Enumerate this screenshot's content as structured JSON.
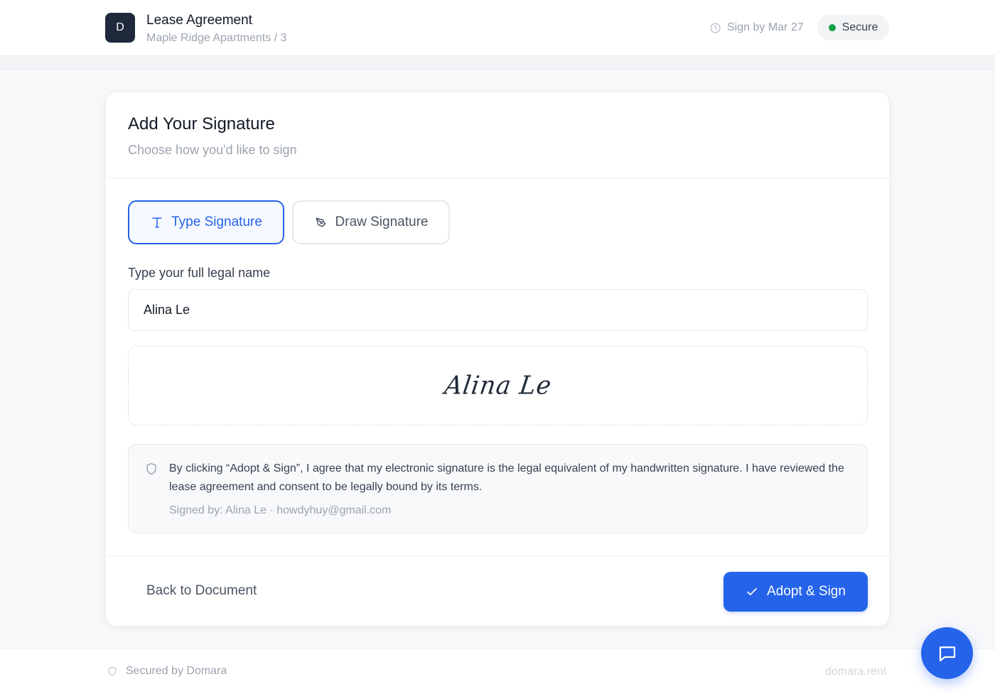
{
  "header": {
    "logo_letter": "D",
    "title": "Lease Agreement",
    "subtitle": "Maple Ridge Apartments / 3",
    "deadline": "Sign by Mar 27",
    "deadline_icon": "clock-icon",
    "secure_label": "Secure",
    "secure_color": "#16a34a"
  },
  "card": {
    "title": "Add Your Signature",
    "subtitle": "Choose how you'd like to sign",
    "modes": {
      "type_label": "Type Signature",
      "draw_label": "Draw Signature",
      "selected": "Type Signature"
    },
    "name_label": "Type your full legal name",
    "name_value": "Alina Le",
    "signature_preview": "Alina Le",
    "consent": {
      "text": "By clicking “Adopt & Sign”, I agree that my electronic signature is the legal equivalent of my handwritten signature. I have reviewed the lease agreement and consent to be legally bound by its terms.",
      "signed_by": "Signed by: Alina Le · howdyhuy@gmail.com"
    },
    "back_label": "Back to Document",
    "adopt_label": "Adopt & Sign",
    "accent_color": "#2563eb"
  },
  "footer": {
    "secured_by": "Secured by Domara",
    "domain": "domara.rent"
  }
}
